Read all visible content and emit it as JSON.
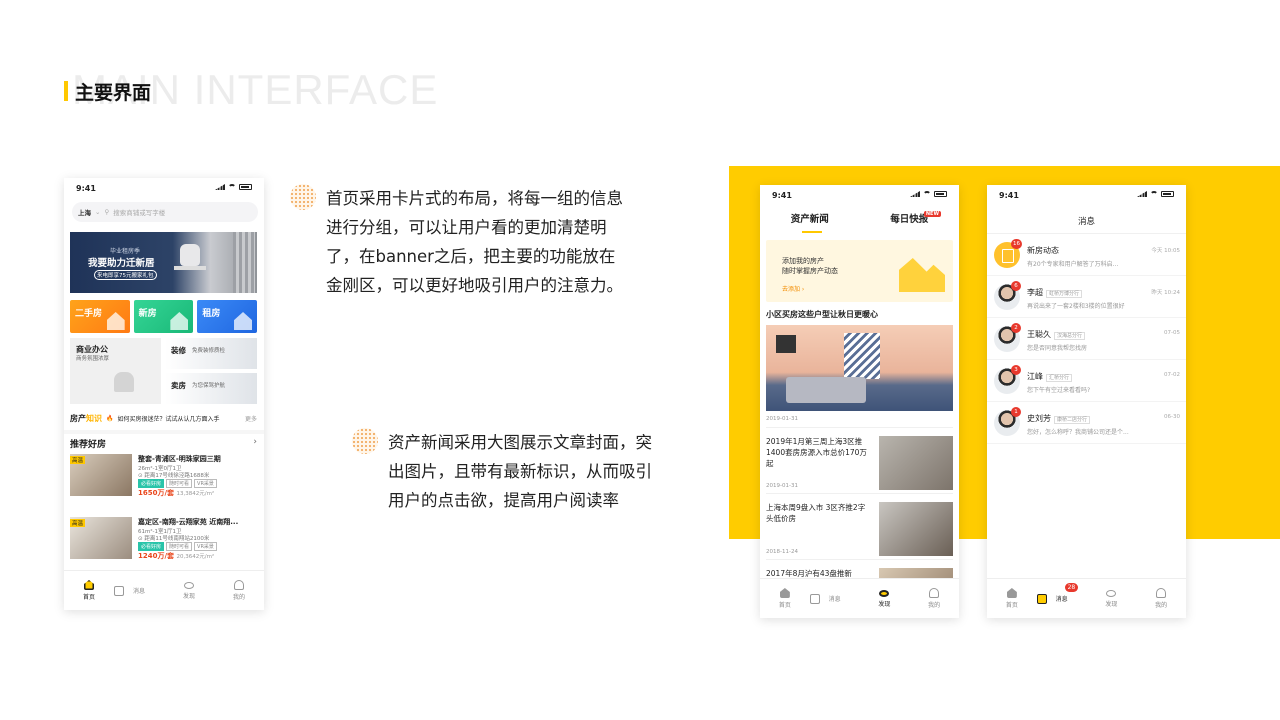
{
  "header": {
    "bg_text": "MAIN INTERFACE",
    "title": "主要界面"
  },
  "desc1": {
    "lines": [
      "首页采用卡片式的布局，将每一组的信息",
      "进行分组，可以让用户看的更加清楚明",
      "了，在banner之后，把主要的功能放在",
      "金刚区，可以更好地吸引用户的注意力。"
    ]
  },
  "desc2": {
    "lines": [
      "资产新闻采用大图展示文章封面，突",
      "出图片，且带有最新标识，从而吸引",
      "用户的点击欲，提高用户阅读率"
    ]
  },
  "colors": {
    "accent": "#ffcc00",
    "price": "#e9461c",
    "badge": "#e8392d"
  },
  "phone1": {
    "time": "9:41",
    "city": "上海",
    "search_placeholder": "搜索商铺或写字楼",
    "banner": {
      "sub": "毕业租房季",
      "title": "我要助力迁新居",
      "cta": "来电即享75元搬家礼包"
    },
    "quick": [
      {
        "label": "二手房"
      },
      {
        "label": "新房"
      },
      {
        "label": "租房"
      }
    ],
    "grid": {
      "big_title": "商业办公",
      "big_sub": "商务氛围浓厚",
      "item1_title": "装修",
      "item1_sub": "免费装修质检",
      "item2_title": "卖房",
      "item2_sub": "为您保驾护航"
    },
    "news": {
      "logo_a": "房产",
      "logo_b": "知识",
      "text": "如何买房很迷茫？试试从认几方面入手",
      "more": "更多"
    },
    "rec_title": "推荐好房",
    "rec_more": "›",
    "listings": [
      {
        "tag": "高温",
        "title": "整套-青浦区-明珠家园三期",
        "info": "26m²-1室0厅1卫",
        "addr": "距离17号线徐泾路1688米",
        "tags": [
          "必看好房",
          "随时可看",
          "VR采景"
        ],
        "price": "1650万/套",
        "unit": "13,3842元/m²"
      },
      {
        "tag": "高温",
        "title": "嘉定区-南翔-云翔家苑 近南翔...",
        "info": "61m²-1室1厅1卫",
        "addr": "距离11号线南翔站2100米",
        "tags": [
          "必看好房",
          "随时可看",
          "VR采景"
        ],
        "price": "1240万/套",
        "unit": "20,3642元/m²"
      }
    ],
    "tabs": [
      "首页",
      "消息",
      "发现",
      "我的"
    ]
  },
  "phone2": {
    "time": "9:41",
    "tab1": "资产新闻",
    "tab2": "每日快报",
    "new_badge": "NEW",
    "card": {
      "l1": "添加我的房产",
      "l2": "随时掌握房产动态",
      "l3": "去添加"
    },
    "headline": "小区买房这些户型让秋日更暖心",
    "hero_date": "2019-01-31",
    "articles": [
      {
        "title": "2019年1月第三周上海3区推1400套房房源入市总价170万起",
        "date": "2019-01-31"
      },
      {
        "title": "上海本周9盘入市 3区齐推2字头低价房",
        "date": "2018-11-24"
      },
      {
        "title": "2017年8月沪有43盘推新",
        "date": ""
      }
    ],
    "tabs": [
      "首页",
      "消息",
      "发现",
      "我的"
    ]
  },
  "phone3": {
    "time": "9:41",
    "title": "消息",
    "messages": [
      {
        "name": "新房动态",
        "org": "",
        "time": "今天 10:05",
        "preview": "有20个专家和用户解答了万科启...",
        "badge": "16"
      },
      {
        "name": "李超",
        "org": "虹桥万博分行",
        "time": "昨天 10:24",
        "preview": "再说出来了一套2楼和3楼的位置很好",
        "badge": "6"
      },
      {
        "name": "王聪久",
        "org": "汉海总分行",
        "time": "07-05",
        "preview": "您是否同意我帮您找房",
        "badge": "2"
      },
      {
        "name": "江峰",
        "org": "汇桥分行",
        "time": "07-02",
        "preview": "您下午有空过来看看吗?",
        "badge": "3"
      },
      {
        "name": "史刘芳",
        "org": "康桥二店分行",
        "time": "06-30",
        "preview": "您好，怎么称呼？我商铺公司还是个...",
        "badge": "1"
      }
    ],
    "tab_badge": "28",
    "tabs": [
      "首页",
      "消息",
      "发现",
      "我的"
    ]
  }
}
